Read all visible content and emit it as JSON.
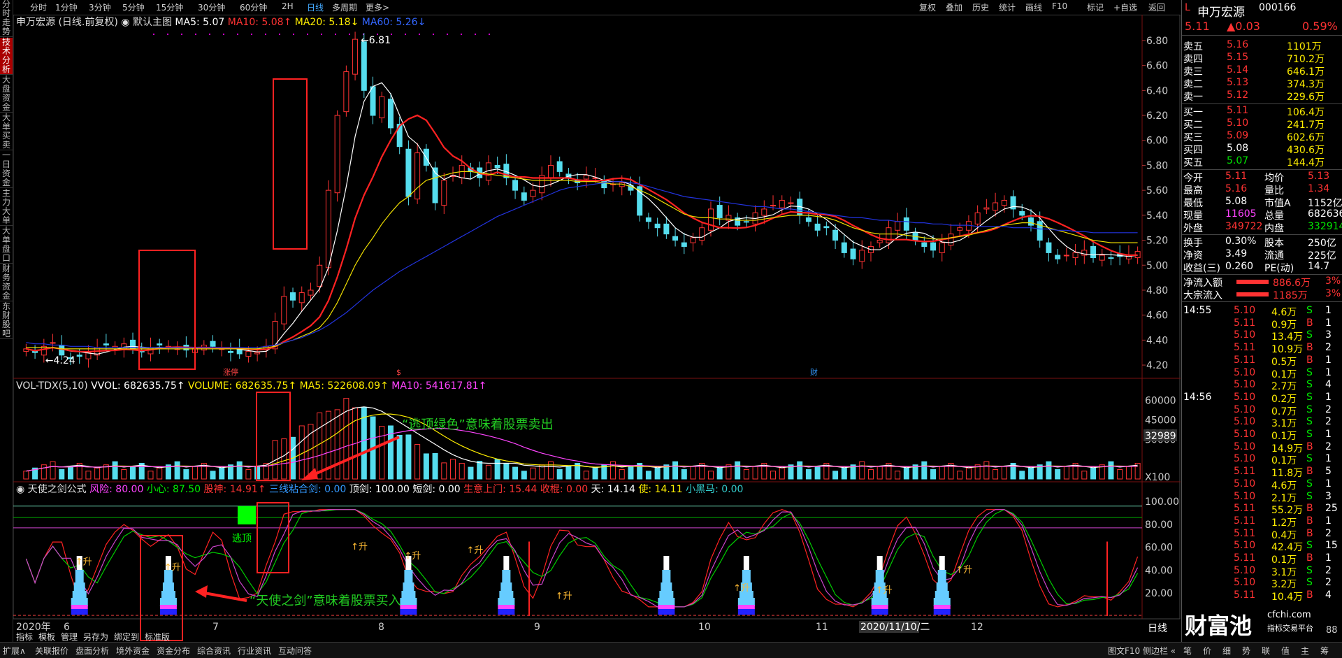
{
  "sidebar_tabs": [
    "分时走势",
    "技术分析",
    "大盘资金",
    "大单买卖",
    "一日资金",
    "主力大单",
    "大单盘口",
    "财务资金",
    "东财股吧"
  ],
  "toolbar": {
    "periods": [
      "分时",
      "1分钟",
      "3分钟",
      "5分钟",
      "15分钟",
      "30分钟",
      "60分钟",
      "2H",
      "日线",
      "多周期",
      "更多>"
    ],
    "selected_period": "日线",
    "right_buttons": [
      "复权",
      "叠加",
      "历史",
      "统计",
      "画线",
      "F10",
      "标记",
      "+自选",
      "返回"
    ]
  },
  "main_header": {
    "stock": "申万宏源 (日线.前复权)",
    "template": "默认主图",
    "ma5": "MA5: 5.07",
    "ma10": "MA10: 5.08",
    "ma20": "MA20: 5.18",
    "ma60": "MA60: 5.26"
  },
  "vol_header": {
    "name": "VOL-TDX(5,10)",
    "vvol": "VVOL: 682635.75",
    "volume": "VOLUME: 682635.75",
    "ma5": "MA5: 522608.09",
    "ma10": "MA10: 541617.81"
  },
  "ind_header": {
    "name": "天使之剑公式",
    "fx": "风险: 80.00",
    "xx": "小心: 87.50",
    "gs": "股神: 14.91",
    "xs": "三线粘合剑: 0.00",
    "dj": "顶剑: 100.00",
    "dj2": "短剑: 0.00",
    "sy": "生意上门: 15.44",
    "sg": "收棍: 0.00",
    "tian": "天: 14.14",
    "shi": "使: 14.11",
    "xhm": "小黑马: 0.00"
  },
  "annotations": {
    "high": "6.81",
    "low": "4.24",
    "sell": "“逃顶绿色”意味着股票卖出",
    "buy": "“天使之剑”意味着股票买入",
    "taoding": "逃顶",
    "sheng": "升",
    "cai": "财",
    "zhangting": "涨停",
    "dollar": "$"
  },
  "x_labels": {
    "year": "2020年",
    "months": [
      "6",
      "7",
      "8",
      "9",
      "10",
      "11",
      "12"
    ],
    "cursor_date": "2020/11/10/二"
  },
  "bottom_small": [
    "指标",
    "模板",
    "管理",
    "另存为",
    "绑定到",
    "标准版"
  ],
  "bottom_tabs": [
    "扩展∧",
    "关联报价",
    "盘面分析",
    "境外资金",
    "资金分布",
    "综合资讯",
    "行业资讯",
    "互动问答"
  ],
  "bottom_right": "图文F10 侧边栏 «",
  "x_scale": "日线",
  "x_mult": "X100",
  "vol_current": "32989",
  "stock_panel": {
    "name": "申万宏源",
    "code": "000166",
    "price": "5.11",
    "change": "▲0.03",
    "pct": "0.59%",
    "asks": [
      [
        "卖五",
        "5.16",
        "1101万"
      ],
      [
        "卖四",
        "5.15",
        "710.2万"
      ],
      [
        "卖三",
        "5.14",
        "646.1万"
      ],
      [
        "卖二",
        "5.13",
        "374.3万"
      ],
      [
        "卖一",
        "5.12",
        "229.6万"
      ]
    ],
    "bids": [
      [
        "买一",
        "5.11",
        "106.4万"
      ],
      [
        "买二",
        "5.10",
        "241.7万"
      ],
      [
        "买三",
        "5.09",
        "602.6万"
      ],
      [
        "买四",
        "5.08",
        "430.6万"
      ],
      [
        "买五",
        "5.07",
        "144.4万"
      ]
    ],
    "stats": [
      [
        "今开",
        "5.11",
        "均价",
        "5.13"
      ],
      [
        "最高",
        "5.16",
        "量比",
        "1.34"
      ],
      [
        "最低",
        "5.08",
        "市值A",
        "1152亿"
      ],
      [
        "现量",
        "11605",
        "总量",
        "682636"
      ],
      [
        "外盘",
        "349722",
        "内盘",
        "332914"
      ],
      [
        "换手",
        "0.30%",
        "股本",
        "250亿"
      ],
      [
        "净资",
        "3.49",
        "流通",
        "225亿"
      ],
      [
        "收益(三)",
        "0.260",
        "PE(动)",
        "14.7"
      ]
    ],
    "flows": [
      [
        "净流入额",
        "886.6万",
        "3%"
      ],
      [
        "大宗流入",
        "1185万",
        "3%"
      ]
    ],
    "ticks_1455": [
      [
        "5.10",
        "4.6万",
        "S",
        "1"
      ],
      [
        "5.11",
        "0.9万",
        "B",
        "1"
      ],
      [
        "5.10",
        "13.4万",
        "S",
        "3"
      ],
      [
        "5.11",
        "10.9万",
        "B",
        "2"
      ],
      [
        "5.11",
        "0.5万",
        "B",
        "1"
      ],
      [
        "5.10",
        "0.1万",
        "S",
        "1"
      ],
      [
        "5.10",
        "2.7万",
        "S",
        "4"
      ]
    ],
    "ticks_1456": [
      [
        "5.10",
        "0.2万",
        "S",
        "1"
      ],
      [
        "5.10",
        "0.7万",
        "S",
        "2"
      ],
      [
        "5.10",
        "3.1万",
        "S",
        "2"
      ],
      [
        "5.10",
        "0.1万",
        "S",
        "1"
      ],
      [
        "5.10",
        "14.9万",
        "B",
        "2"
      ],
      [
        "5.10",
        "0.1万",
        "S",
        "1"
      ],
      [
        "5.11",
        "11.8万",
        "B",
        "5"
      ],
      [
        "5.10",
        "4.6万",
        "S",
        "1"
      ],
      [
        "5.10",
        "2.1万",
        "S",
        "3"
      ],
      [
        "5.11",
        "55.2万",
        "B",
        "25"
      ],
      [
        "5.11",
        "1.2万",
        "B",
        "1"
      ],
      [
        "5.11",
        "0.4万",
        "B",
        "2"
      ],
      [
        "5.10",
        "42.4万",
        "S",
        "15"
      ],
      [
        "5.11",
        "0.1万",
        "B",
        "1"
      ],
      [
        "5.10",
        "3.1万",
        "S",
        "2"
      ],
      [
        "5.10",
        "3.2万",
        "S",
        "2"
      ],
      [
        "5.11",
        "10.4万",
        "B",
        "4"
      ]
    ],
    "time1": "14:55",
    "time2": "14:56",
    "last_vol": "88",
    "bottom_tabs": [
      "笔",
      "价",
      "细",
      "势",
      "联",
      "值",
      "主",
      "筹"
    ]
  },
  "logo": {
    "text": "财富池",
    "site": "cfchi.com",
    "sub": "指标交易平台"
  },
  "chart_data": [
    {
      "type": "candlestick",
      "title": "申万宏源 (日线.前复权)",
      "y_ticks": [
        4.2,
        4.4,
        4.6,
        4.8,
        5.0,
        5.2,
        5.4,
        5.6,
        5.8,
        6.0,
        6.2,
        6.4,
        6.6,
        6.8
      ],
      "ylim": [
        4.15,
        6.85
      ],
      "close_series": [
        4.33,
        4.3,
        4.35,
        4.38,
        4.28,
        4.25,
        4.27,
        4.3,
        4.34,
        4.36,
        4.35,
        4.37,
        4.33,
        4.31,
        4.34,
        4.36,
        4.35,
        4.33,
        4.32,
        4.34,
        4.36,
        4.35,
        4.33,
        4.3,
        4.29,
        4.31,
        4.3,
        4.35,
        4.55,
        4.75,
        4.72,
        4.78,
        4.8,
        5.0,
        5.6,
        6.2,
        6.55,
        6.81,
        6.4,
        6.2,
        6.35,
        6.1,
        5.95,
        5.55,
        5.9,
        5.8,
        5.5,
        5.68,
        5.72,
        5.8,
        5.75,
        5.7,
        5.82,
        5.78,
        5.7,
        5.6,
        5.52,
        5.6,
        5.72,
        5.8,
        5.75,
        5.7,
        5.66,
        5.72,
        5.7,
        5.62,
        5.65,
        5.66,
        5.6,
        5.4,
        5.35,
        5.3,
        5.25,
        5.2,
        5.15,
        5.22,
        5.3,
        5.45,
        5.38,
        5.4,
        5.32,
        5.35,
        5.42,
        5.45,
        5.48,
        5.52,
        5.5,
        5.4,
        5.35,
        5.28,
        5.3,
        5.2,
        5.1,
        5.05,
        5.12,
        5.15,
        5.2,
        5.3,
        5.35,
        5.28,
        5.2,
        5.15,
        5.12,
        5.18,
        5.25,
        5.3,
        5.35,
        5.42,
        5.46,
        5.5,
        5.52,
        5.45,
        5.4,
        5.32,
        5.2,
        5.1,
        5.05,
        5.08,
        5.1,
        5.12,
        5.06,
        5.08,
        5.06,
        5.07,
        5.08,
        5.11
      ],
      "ma20_series": [
        4.34,
        4.34,
        4.34,
        4.34,
        4.33,
        4.33,
        4.33,
        4.33,
        4.33,
        4.33,
        4.33,
        4.33,
        4.33,
        4.33,
        4.33,
        4.33,
        4.33,
        4.33,
        4.33,
        4.33,
        4.33,
        4.33,
        4.33,
        4.33,
        4.33,
        4.33,
        4.33,
        4.34,
        4.35,
        4.38,
        4.4,
        4.43,
        4.46,
        4.5,
        4.58,
        4.7,
        4.85,
        5.0,
        5.12,
        5.22,
        5.33,
        5.42,
        5.5,
        5.55,
        5.62,
        5.68,
        5.7,
        5.72,
        5.74,
        5.75,
        5.75,
        5.74,
        5.73,
        5.72,
        5.71,
        5.7,
        5.69,
        5.68,
        5.68,
        5.68,
        5.68,
        5.68,
        5.67,
        5.67,
        5.67,
        5.66,
        5.65,
        5.65,
        5.63,
        5.6,
        5.57,
        5.53,
        5.49,
        5.45,
        5.41,
        5.39,
        5.38,
        5.38,
        5.37,
        5.37,
        5.36,
        5.36,
        5.36,
        5.37,
        5.38,
        5.39,
        5.4,
        5.4,
        5.4,
        5.39,
        5.38,
        5.36,
        5.33,
        5.3,
        5.28,
        5.26,
        5.25,
        5.25,
        5.25,
        5.24,
        5.23,
        5.22,
        5.21,
        5.21,
        5.22,
        5.23,
        5.24,
        5.26,
        5.28,
        5.3,
        5.32,
        5.33,
        5.34,
        5.34,
        5.32,
        5.3,
        5.28,
        5.26,
        5.24,
        5.22,
        5.2,
        5.19,
        5.18,
        5.18,
        5.18,
        5.18
      ],
      "ma60_series": [
        4.38,
        4.37,
        4.37,
        4.36,
        4.36,
        4.35,
        4.35,
        4.35,
        4.34,
        4.34,
        4.34,
        4.34,
        4.34,
        4.34,
        4.34,
        4.34,
        4.34,
        4.34,
        4.34,
        4.34,
        4.34,
        4.34,
        4.34,
        4.34,
        4.34,
        4.34,
        4.34,
        4.35,
        4.36,
        4.38,
        4.4,
        4.42,
        4.45,
        4.48,
        4.52,
        4.57,
        4.62,
        4.68,
        4.74,
        4.8,
        4.85,
        4.9,
        4.95,
        4.99,
        5.03,
        5.07,
        5.11,
        5.15,
        5.19,
        5.23,
        5.27,
        5.31,
        5.35,
        5.39,
        5.42,
        5.45,
        5.48,
        5.51,
        5.54,
        5.57,
        5.6,
        5.62,
        5.63,
        5.64,
        5.65,
        5.66,
        5.67,
        5.67,
        5.66,
        5.65,
        5.63,
        5.61,
        5.59,
        5.57,
        5.55,
        5.54,
        5.53,
        5.52,
        5.51,
        5.5,
        5.49,
        5.48,
        5.47,
        5.47,
        5.46,
        5.45,
        5.45,
        5.44,
        5.43,
        5.42,
        5.41,
        5.4,
        5.39,
        5.38,
        5.38,
        5.37,
        5.36,
        5.36,
        5.35,
        5.35,
        5.34,
        5.34,
        5.33,
        5.33,
        5.32,
        5.32,
        5.32,
        5.31,
        5.31,
        5.31,
        5.31,
        5.3,
        5.3,
        5.3,
        5.29,
        5.29,
        5.28,
        5.28,
        5.27,
        5.27,
        5.26,
        5.26,
        5.26,
        5.26,
        5.26,
        5.26
      ]
    },
    {
      "type": "bar",
      "title": "VOL-TDX(5,10)",
      "y_ticks": [
        30000,
        35000,
        45000,
        60000
      ],
      "ylim": [
        0,
        65000
      ]
    },
    {
      "type": "line",
      "title": "天使之剑公式",
      "y_ticks": [
        20,
        40,
        60,
        80,
        100
      ],
      "ylim": [
        0,
        105
      ],
      "reference_levels": [
        77,
        86,
        96
      ]
    }
  ]
}
